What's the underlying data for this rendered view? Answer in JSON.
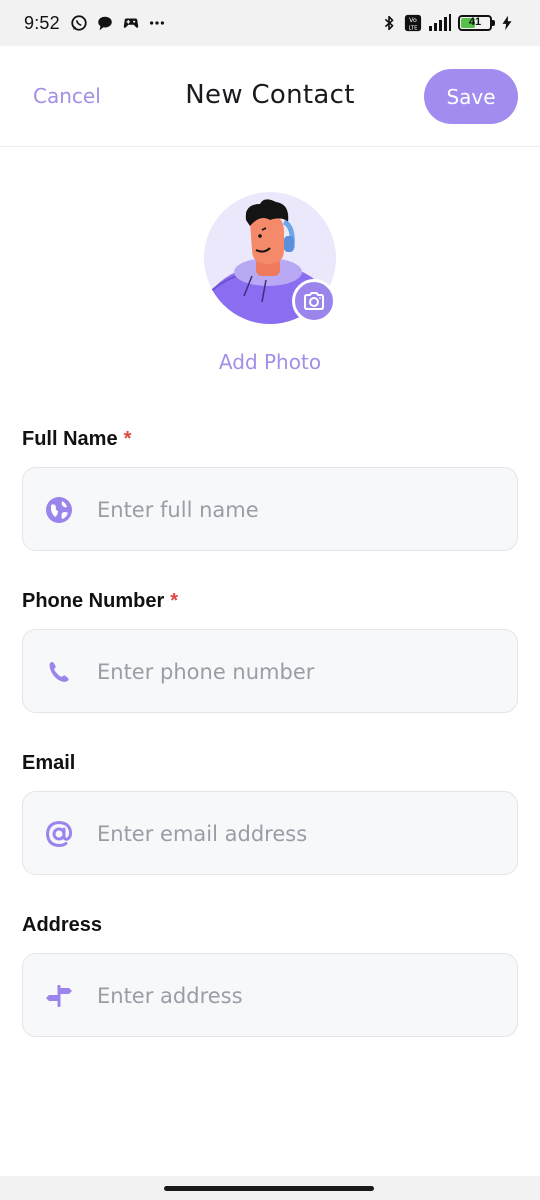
{
  "status_bar": {
    "time": "9:52",
    "battery": "41",
    "left_icons": [
      "whatsapp-icon",
      "chat-bubble-icon",
      "game-controller-icon",
      "more-dots-icon"
    ],
    "right_icons": [
      "bluetooth-icon",
      "volte-icon",
      "signal-icon",
      "battery-icon",
      "charging-icon"
    ]
  },
  "header": {
    "cancel_label": "Cancel",
    "title": "New Contact",
    "save_label": "Save"
  },
  "photo": {
    "add_photo_label": "Add Photo"
  },
  "form": {
    "fields": [
      {
        "label": "Full Name",
        "required": true,
        "placeholder": "Enter full name",
        "icon": "globe-icon"
      },
      {
        "label": "Phone Number",
        "required": true,
        "placeholder": "Enter phone number",
        "icon": "phone-icon"
      },
      {
        "label": "Email",
        "required": false,
        "placeholder": "Enter email address",
        "icon": "at-icon"
      },
      {
        "label": "Address",
        "required": false,
        "placeholder": "Enter address",
        "icon": "signpost-icon"
      }
    ],
    "required_mark": "*"
  },
  "colors": {
    "accent": "#a38cf0",
    "accent_text": "#a48ee8",
    "required": "#e0463f",
    "field_bg": "#f7f8fa"
  }
}
